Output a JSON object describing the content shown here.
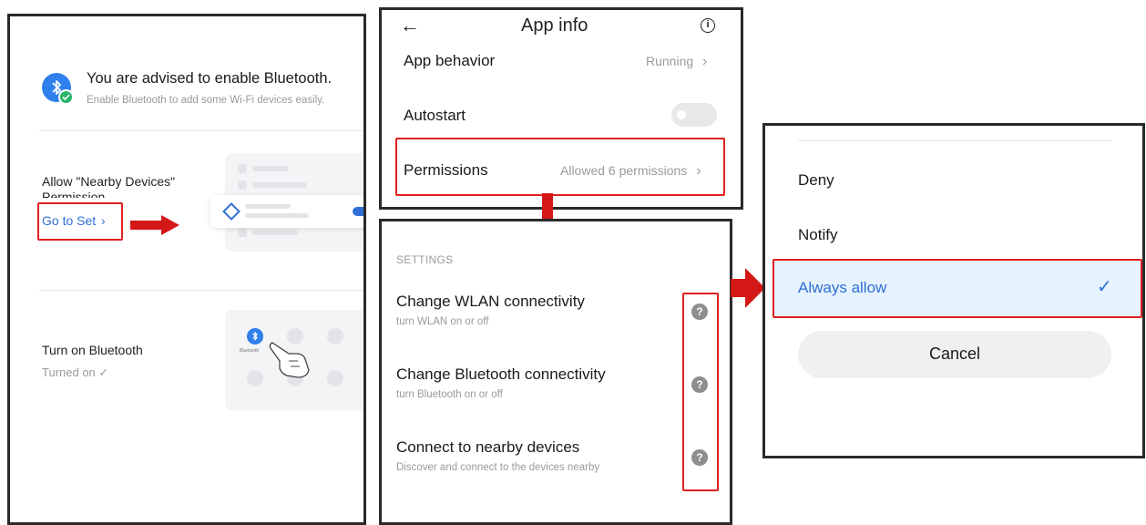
{
  "panel1": {
    "bt_title": "You are advised to enable Bluetooth.",
    "bt_subtitle": "Enable Bluetooth to add some Wi-Fi devices easily.",
    "nearby_line1": "Allow \"Nearby Devices\"",
    "nearby_line2": "Permission",
    "go_to_set": "Go to Set",
    "chevron": "›",
    "turn_on_label": "Turn on Bluetooth",
    "turned_on": "Turned on ✓",
    "mock_bt_label": "Bluetooth"
  },
  "panel2": {
    "title": "App info",
    "back": "←",
    "info": "i",
    "app_behavior_label": "App behavior",
    "app_behavior_value": "Running",
    "autostart_label": "Autostart",
    "permissions_label": "Permissions",
    "permissions_value": "Allowed 6 permissions",
    "chevron": "›"
  },
  "panel3": {
    "section": "SETTINGS",
    "items": [
      {
        "title": "Change WLAN connectivity",
        "subtitle": "turn WLAN on or off"
      },
      {
        "title": "Change Bluetooth connectivity",
        "subtitle": "turn Bluetooth on or off"
      },
      {
        "title": "Connect to nearby devices",
        "subtitle": "Discover and connect to the devices nearby"
      }
    ],
    "help": "?"
  },
  "panel4": {
    "deny": "Deny",
    "notify": "Notify",
    "always_allow": "Always allow",
    "check": "✓",
    "cancel": "Cancel"
  },
  "colors": {
    "accent": "#2f6fd6",
    "highlight": "#e6f2fd",
    "annotation_red": "#e02020"
  }
}
